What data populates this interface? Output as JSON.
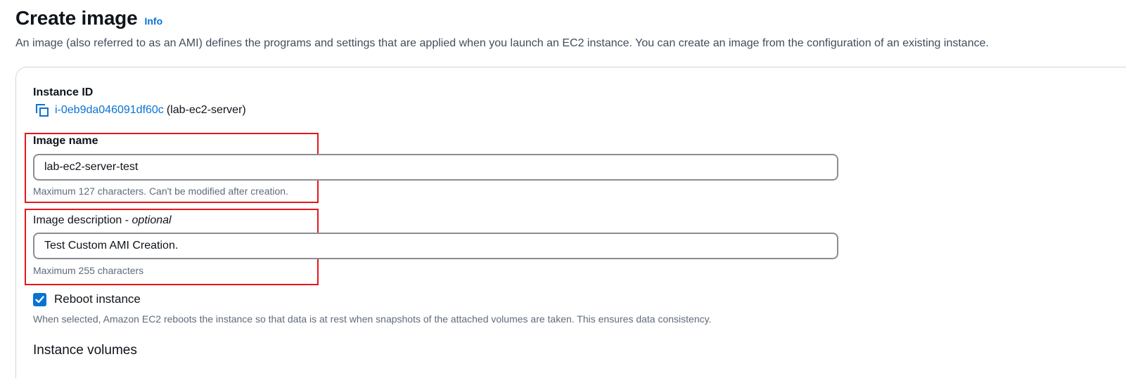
{
  "header": {
    "title": "Create image",
    "info_label": "Info",
    "description": "An image (also referred to as an AMI) defines the programs and settings that are applied when you launch an EC2 instance. You can create an image from the configuration of an existing instance."
  },
  "form": {
    "instance_id": {
      "label": "Instance ID",
      "value": "i-0eb9da046091df60c",
      "name": "(lab-ec2-server)",
      "icon": "copy-icon"
    },
    "image_name": {
      "label": "Image name",
      "value": "lab-ec2-server-test",
      "hint": "Maximum 127 characters. Can't be modified after creation."
    },
    "image_description": {
      "label": "Image description - ",
      "label_optional": "optional",
      "value": "Test Custom AMI Creation.",
      "hint": "Maximum 255 characters"
    },
    "reboot": {
      "label": "Reboot instance",
      "checked": true,
      "hint": "When selected, Amazon EC2 reboots the instance so that data is at rest when snapshots of the attached volumes are taken. This ensures data consistency."
    },
    "volumes_section_title": "Instance volumes"
  },
  "colors": {
    "link": "#0972d3",
    "highlight": "#e5161b",
    "hint_text": "#5f6b7a"
  }
}
